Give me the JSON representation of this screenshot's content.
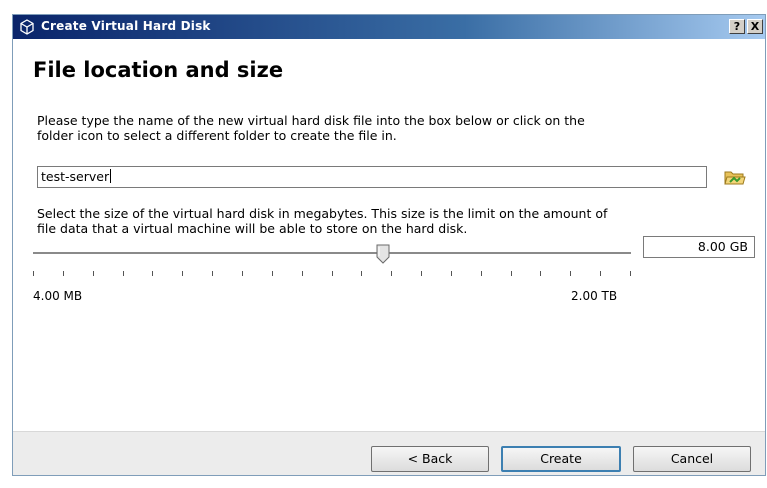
{
  "window": {
    "title": "Create Virtual Hard Disk",
    "help_label": "?",
    "close_label": "X"
  },
  "page": {
    "heading": "File location and size",
    "location_text_line1": "Please type the name of the new virtual hard disk file into the box below or click on the",
    "location_text_line2": "folder icon to select a different folder to create the file in.",
    "file_name": "test-server",
    "size_text_line1": "Select the size of the virtual hard disk in megabytes. This size is the limit on the amount of",
    "size_text_line2": "file data that a virtual machine will be able to store on the hard disk.",
    "slider": {
      "min_label": "4.00 MB",
      "max_label": "2.00 TB",
      "level": 0.585,
      "tick_count": 21
    },
    "size_value": "8.00 GB"
  },
  "buttons": {
    "back": "< Back",
    "create": "Create",
    "cancel": "Cancel"
  },
  "icons": {
    "title_icon": "virtualbox-icon",
    "folder_icon": "folder-open-icon"
  },
  "colors": {
    "titlebar_start": "#0a246a",
    "titlebar_end": "#a6caf0",
    "default_button_border": "#3c7fb1"
  }
}
